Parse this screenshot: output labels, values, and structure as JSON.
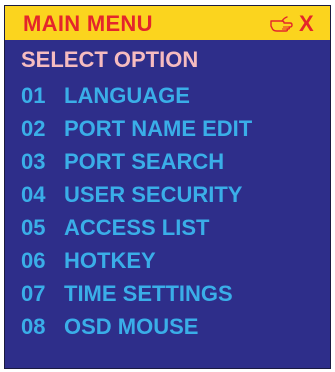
{
  "osd": {
    "title": "MAIN MENU",
    "pointer_icon": "pointing-hand-icon",
    "close_label": "X",
    "subtitle": "SELECT OPTION",
    "items": [
      {
        "number": "01",
        "label": "LANGUAGE"
      },
      {
        "number": "02",
        "label": "PORT NAME EDIT"
      },
      {
        "number": "03",
        "label": "PORT SEARCH"
      },
      {
        "number": "04",
        "label": "USER SECURITY"
      },
      {
        "number": "05",
        "label": "ACCESS LIST"
      },
      {
        "number": "06",
        "label": "HOTKEY"
      },
      {
        "number": "07",
        "label": "TIME SETTINGS"
      },
      {
        "number": "08",
        "label": "OSD MOUSE"
      }
    ]
  },
  "colors": {
    "titlebar_bg": "#fbd41e",
    "title_text": "#e4262b",
    "panel_bg": "#2e2e8a",
    "subtitle_text": "#f6bcc0",
    "item_text": "#3aaee8"
  }
}
